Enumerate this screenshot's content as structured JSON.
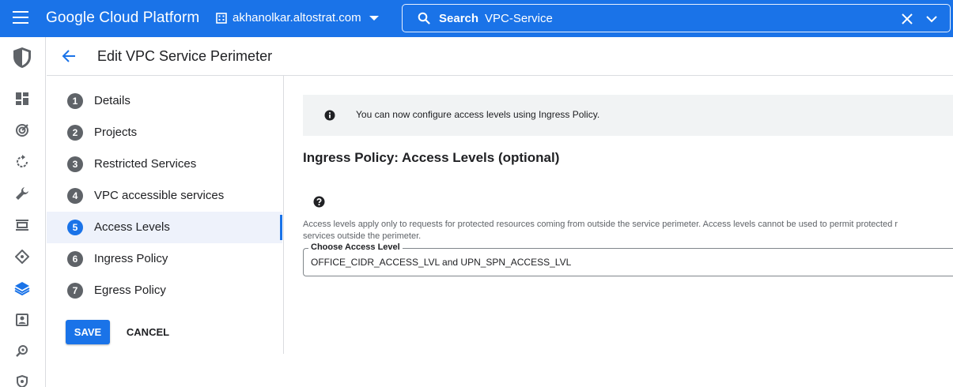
{
  "topbar": {
    "brand": "Google Cloud Platform",
    "org_name": "akhanolkar.altostrat.com",
    "search_label": "Search",
    "search_value": "VPC-Service"
  },
  "rail": {
    "icons": [
      "security-shield-icon",
      "dashboard-icon",
      "target-icon",
      "refresh-icon",
      "wrench-icon",
      "list-icon",
      "diamond-icon",
      "vpc-layers-icon",
      "badge-icon",
      "key-search-icon",
      "shield-small-icon"
    ]
  },
  "header": {
    "title": "Edit VPC Service Perimeter"
  },
  "stepper": {
    "steps": [
      {
        "num": "1",
        "label": "Details"
      },
      {
        "num": "2",
        "label": "Projects"
      },
      {
        "num": "3",
        "label": "Restricted Services"
      },
      {
        "num": "4",
        "label": "VPC accessible services"
      },
      {
        "num": "5",
        "label": "Access Levels"
      },
      {
        "num": "6",
        "label": "Ingress Policy"
      },
      {
        "num": "7",
        "label": "Egress Policy"
      }
    ],
    "active_index": 4,
    "save_label": "SAVE",
    "cancel_label": "CANCEL"
  },
  "main": {
    "banner_text": "You can now configure access levels using Ingress Policy.",
    "section_title": "Ingress Policy: Access Levels (optional)",
    "description_line1": "Access levels apply only to requests for protected resources coming from outside the service perimeter. Access levels cannot be used to permit protected r",
    "description_line2": "services outside the perimeter.",
    "field_label": "Choose Access Level",
    "field_value": "OFFICE_CIDR_ACCESS_LVL and UPN_SPN_ACCESS_LVL"
  },
  "colors": {
    "brand_blue": "#1a73e8",
    "active_step_bg": "#eef2fb",
    "banner_bg": "#f1f3f4"
  }
}
